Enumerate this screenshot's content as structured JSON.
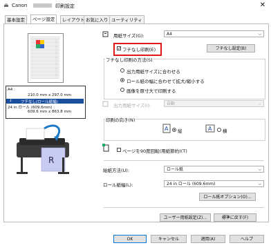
{
  "window": {
    "title_prefix": "Canon",
    "title_suffix": "印刷設定",
    "close_glyph": "✕"
  },
  "tabs": [
    "基本設定",
    "ページ設定",
    "レイアウト",
    "お気に入り",
    "ユーティリティ"
  ],
  "preview_info": {
    "size_label": "A4 :",
    "size_dims": "210.0 mm x 297.0 mm",
    "mode": "フチなし(ロール紙幅)",
    "roll_label": "24 in ロール (609.6mm) :",
    "roll_dims": "609.6 mm x 863.8 mm"
  },
  "paper_size": {
    "label": "用紙サイズ(G):",
    "value": "A4"
  },
  "borderless": {
    "label": "フチなし印刷(E)",
    "checked": true,
    "settings_button": "フチなし設定(B)"
  },
  "borderless_method": {
    "label": "フチなし印刷の方法(S)",
    "options": [
      "出力用紙サイズに合わせる",
      "ロール紙の幅に合わせて拡大/縮小する",
      "画像を原寸大で印刷する"
    ],
    "selected": 1
  },
  "output_size": {
    "label": "出力用紙サイズ(I):",
    "value": "自動"
  },
  "orientation": {
    "label": "印刷の向き(N)",
    "portrait": "縦",
    "landscape": "横",
    "selected": "portrait"
  },
  "rotate": {
    "label": "ページを90度回転(用紙節約)(T)",
    "checked": false
  },
  "feed": {
    "label": "給紙方法(U):",
    "value": "ロール紙"
  },
  "roll_width": {
    "label": "ロール紙幅(L):",
    "value": "24 in ロール (609.6mm)"
  },
  "buttons": {
    "roll_options": "ロール紙オプション(O)...",
    "user_paper": "ユーザー用紙設定(Z)...",
    "defaults": "標準に戻す(F)",
    "ok": "OK",
    "cancel": "キャンセル",
    "apply": "適用(A)",
    "help": "ヘルプ"
  },
  "colors": {
    "highlight": "#1a4fa0",
    "red_frame": "#e0191b"
  }
}
